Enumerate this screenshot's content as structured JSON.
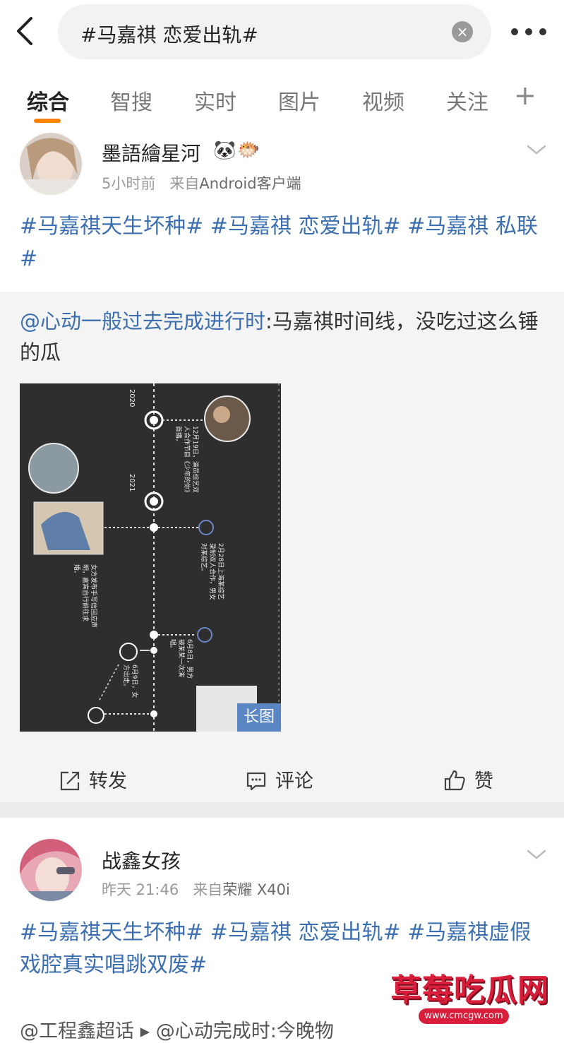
{
  "search": {
    "query": "#马嘉祺 恋爱出轨#"
  },
  "tabs": [
    {
      "label": "综合"
    },
    {
      "label": "智搜"
    },
    {
      "label": "实时"
    },
    {
      "label": "图片"
    },
    {
      "label": "视频"
    },
    {
      "label": "关注"
    }
  ],
  "tab_add_label": "+",
  "posts": [
    {
      "username": "墨語繪星河",
      "time": "5小时前",
      "source_prefix": "来自",
      "source": "Android客户端",
      "text": "#马嘉祺天生坏种# #马嘉祺 恋爱出轨# #马嘉祺 私联#",
      "repost_mention": "@心动一般过去完成进行时",
      "repost_text": ":马嘉祺时间线，没吃过这么锤的瓜",
      "image_badge": "长图",
      "image_text": {
        "year_2020": "2020",
        "year_2021": "2021",
        "note_dec19": "12月19日，演员综艺双人合作节目《少年的你》首播。",
        "note_feb28": "2月28日上海某综艺录制双人合作，男女对某综艺。",
        "note_left": "女方发布手写信回应声明，嘉宾自行前往求婚。",
        "note_jun8": "6月8日，男方被某某一次演唱。",
        "note_jun9": "6月9日，女方出走。"
      }
    },
    {
      "username": "战鑫女孩",
      "time": "昨天 21:46",
      "source_prefix": "来自",
      "source": "荣耀 X40i",
      "text": "#马嘉祺天生坏种# #马嘉祺 恋爱出轨# #马嘉祺虚假戏腔真实唱跳双废#",
      "sub_text": "@工程鑫超话 ▸ @心动完成时:今晚物"
    }
  ],
  "actions": {
    "repost": "转发",
    "comment": "评论",
    "like": "赞"
  },
  "watermark": {
    "title": "草莓吃瓜网",
    "url": "www.cmcgw.com"
  },
  "colors": {
    "accent": "#ff8200",
    "link": "#3b6fb0"
  }
}
